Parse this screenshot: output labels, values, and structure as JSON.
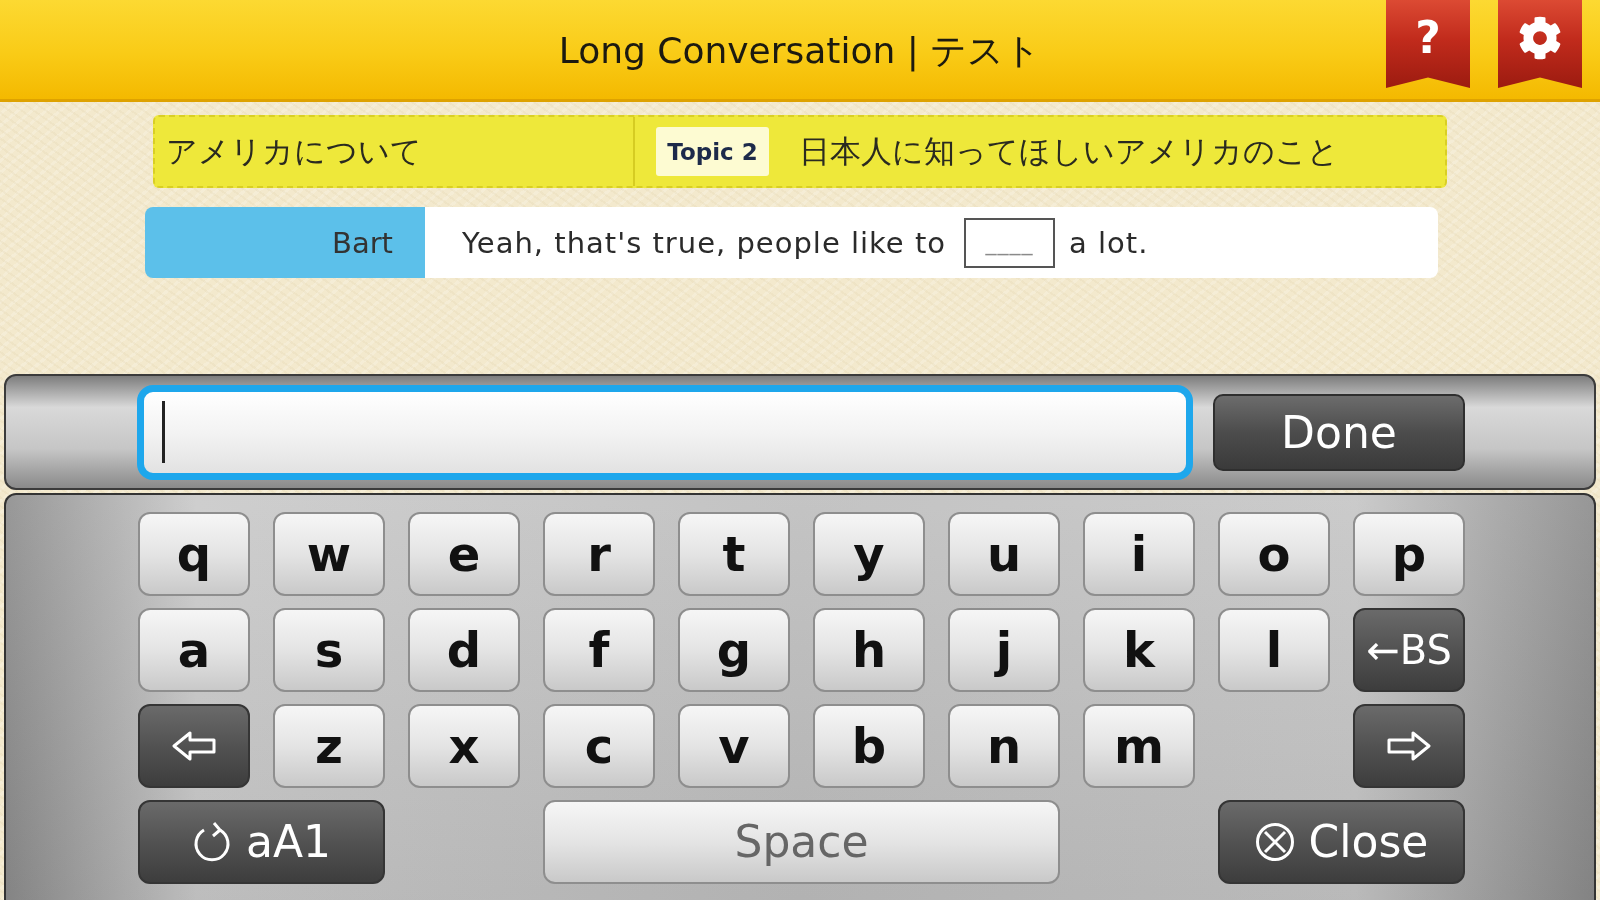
{
  "header": {
    "title": "Long Conversation | テスト",
    "buttons": [
      {
        "kind": "help",
        "label": "?"
      },
      {
        "kind": "settings"
      }
    ]
  },
  "topic_bar": {
    "category": "アメリカについて",
    "badge": "Topic 2",
    "topic": "日本人に知ってほしいアメリカのこと"
  },
  "dialogue": {
    "speaker": "Bart",
    "text_before": "Yeah, that's true, people like to",
    "blank": "____",
    "text_after": "a lot."
  },
  "input_bar": {
    "answer_field": {
      "focused": true
    },
    "done_button": "Done"
  },
  "keyboard": {
    "rows": [
      [
        {
          "kind": "letter",
          "label": "q"
        },
        {
          "kind": "letter",
          "label": "w"
        },
        {
          "kind": "letter",
          "label": "e"
        },
        {
          "kind": "letter",
          "label": "r"
        },
        {
          "kind": "letter",
          "label": "t"
        },
        {
          "kind": "letter",
          "label": "y"
        },
        {
          "kind": "letter",
          "label": "u"
        },
        {
          "kind": "letter",
          "label": "i"
        },
        {
          "kind": "letter",
          "label": "o"
        },
        {
          "kind": "letter",
          "label": "p"
        }
      ],
      [
        {
          "kind": "letter",
          "label": "a"
        },
        {
          "kind": "letter",
          "label": "s"
        },
        {
          "kind": "letter",
          "label": "d"
        },
        {
          "kind": "letter",
          "label": "f"
        },
        {
          "kind": "letter",
          "label": "g"
        },
        {
          "kind": "letter",
          "label": "h"
        },
        {
          "kind": "letter",
          "label": "j"
        },
        {
          "kind": "letter",
          "label": "k"
        },
        {
          "kind": "letter",
          "label": "l"
        },
        {
          "kind": "backspace",
          "label": "←BS"
        }
      ],
      [
        {
          "kind": "cursor_left"
        },
        {
          "kind": "letter",
          "label": "z"
        },
        {
          "kind": "letter",
          "label": "x"
        },
        {
          "kind": "letter",
          "label": "c"
        },
        {
          "kind": "letter",
          "label": "v"
        },
        {
          "kind": "letter",
          "label": "b"
        },
        {
          "kind": "letter",
          "label": "n"
        },
        {
          "kind": "letter",
          "label": "m"
        },
        "",
        {
          "kind": "cursor_right"
        }
      ]
    ],
    "bottom_row": [
      {
        "kind": "mode",
        "label": "aA1"
      },
      {
        "kind": "space",
        "label": "Space"
      },
      {
        "kind": "close",
        "label": "Close"
      }
    ]
  }
}
